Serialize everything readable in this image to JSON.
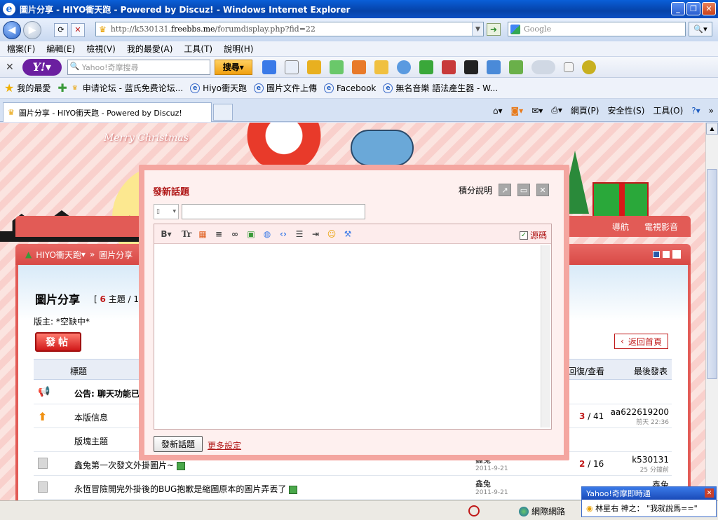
{
  "window": {
    "title": "圖片分享 - HIYO衝天跑 - Powered by Discuz! - Windows Internet Explorer"
  },
  "address": {
    "url_prefix": "http://k530131.",
    "url_domain": "freebbs.me",
    "url_path": "/forumdisplay.php?fid=22",
    "search_placeholder": "Google"
  },
  "menu": [
    "檔案(F)",
    "編輯(E)",
    "檢視(V)",
    "我的最愛(A)",
    "工具(T)",
    "說明(H)"
  ],
  "yahoo": {
    "search_placeholder": "Yahoo!奇摩搜尋",
    "search_button": "搜尋"
  },
  "favorites": {
    "label": "我的最愛",
    "items": [
      "申请论坛 - 蓝氏免费论坛...",
      "Hiyo衝天跑",
      "圖片文件上傳",
      "Facebook",
      "無名音樂 語法產生器 - W..."
    ]
  },
  "tab": {
    "title": "圖片分享 - HIYO衝天跑 - Powered by Discuz!"
  },
  "commandbar": [
    "網頁(P)",
    "安全性(S)",
    "工具(O)"
  ],
  "banner": {
    "tagline": "Merry Christmas"
  },
  "site_nav": [
    "導航",
    "電視影音"
  ],
  "breadcrumb": {
    "home": "HIYO衝天跑",
    "current": "圖片分享"
  },
  "forum": {
    "title": "圖片分享",
    "stats_prefix": "[",
    "topic_count": "6",
    "stats_topics": "主題 / 1",
    "moderator": "版主: *空缺中*",
    "post_button": "發帖",
    "return_button": "返回首頁",
    "columns": {
      "title": "標題",
      "replies": "回復/查看",
      "lastpost": "最後發表"
    },
    "rows": [
      {
        "title": "公告: 聊天功能已",
        "author": "",
        "date": "",
        "replies": "",
        "views": "",
        "last_user": "",
        "last_time": ""
      },
      {
        "title": "本版信息",
        "author": "",
        "date": "",
        "replies": "3",
        "views": "/ 41",
        "last_user": "aa622619200",
        "last_time": "前天 22:36"
      },
      {
        "title": "版塊主題",
        "author": "",
        "date": "",
        "replies": "",
        "views": "",
        "last_user": "",
        "last_time": ""
      },
      {
        "title": "鑫兔第一次發文外掛圖片~",
        "author": "鑫兔",
        "date": "2011-9-21",
        "replies": "2",
        "views": "/ 16",
        "last_user": "k530131",
        "last_time": "25 分鐘前"
      },
      {
        "title": "永恆冒險開完外掛後的BUG抱歉是縮圖原本的圖片弄丟了",
        "author": "鑫兔",
        "date": "2011-9-21",
        "replies": "",
        "views": "",
        "last_user": "鑫兔",
        "last_time": ""
      }
    ]
  },
  "modal": {
    "title": "發新話題",
    "help_link": "積分說明",
    "source_label": "源碼",
    "submit_button": "發新話題",
    "more_settings": "更多設定"
  },
  "status": {
    "zone": "網際網路"
  },
  "yahoo_notify": {
    "header": "Yahoo!奇摩即時通",
    "message": "林星右 神之： \"我就說馬==\""
  },
  "colors": {
    "accent_red": "#e25b56",
    "link_red": "#b01818",
    "ie_blue": "#0542a8"
  }
}
